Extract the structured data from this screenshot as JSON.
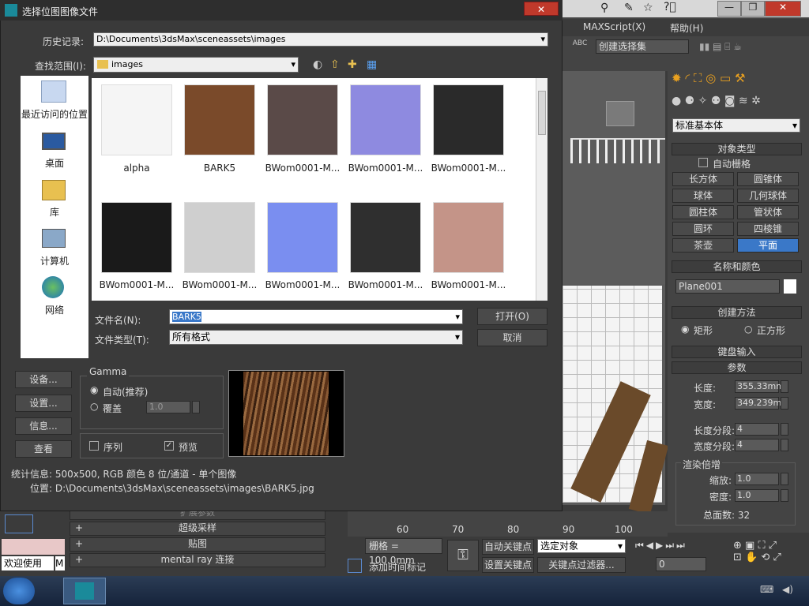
{
  "dialog": {
    "title": "选择位图图像文件",
    "history_label": "历史记录:",
    "history_value": "D:\\Documents\\3dsMax\\sceneassets\\images",
    "lookin_label": "查找范围(I):",
    "lookin_value": "images",
    "places": [
      {
        "label": "最近访问的位置",
        "icon": "recent-places-icon"
      },
      {
        "label": "桌面",
        "icon": "desktop-icon"
      },
      {
        "label": "库",
        "icon": "library-icon"
      },
      {
        "label": "计算机",
        "icon": "computer-icon"
      },
      {
        "label": "网络",
        "icon": "network-icon"
      }
    ],
    "files": [
      {
        "name": "alpha",
        "color": "#f5f5f5"
      },
      {
        "name": "BARK5",
        "color": "#7a4a2a"
      },
      {
        "name": "BWom0001-M...",
        "color": "#5a4a48"
      },
      {
        "name": "BWom0001-M...",
        "color": "#8e8ae0"
      },
      {
        "name": "BWom0001-M...",
        "color": "#2a2a2a"
      },
      {
        "name": "BWom0001-M...",
        "color": "#1a1a1a"
      },
      {
        "name": "BWom0001-M...",
        "color": "#cfcfcf"
      },
      {
        "name": "BWom0001-M...",
        "color": "#7a8ef0"
      },
      {
        "name": "BWom0001-M...",
        "color": "#2f2f2f"
      },
      {
        "name": "BWom0001-M...",
        "color": "#c49488"
      }
    ],
    "filename_label": "文件名(N):",
    "filename_value": "BARK5",
    "filetype_label": "文件类型(T):",
    "filetype_value": "所有格式",
    "open_button": "打开(O)",
    "cancel_button": "取消",
    "setup_button": "设备...",
    "settings_button": "设置...",
    "info_button": "信息...",
    "view_button": "查看",
    "gamma_title": "Gamma",
    "gamma_auto": "自动(推荐)",
    "gamma_override": "覆盖",
    "gamma_value": "1.0",
    "sequence_label": "序列",
    "preview_label": "预览",
    "stats": "统计信息: 500x500, RGB 颜色 8 位/通道 - 单个图像",
    "location": "位置: D:\\Documents\\3dsMax\\sceneassets\\images\\BARK5.jpg"
  },
  "max": {
    "menu_maxscript": "MAXScript(X)",
    "menu_help": "帮助(H)",
    "selection_set": "创建选择集",
    "standard_primitives": "标准基本体",
    "object_type_header": "对象类型",
    "auto_grid": "自动栅格",
    "objects": [
      "长方体",
      "圆锥体",
      "球体",
      "几何球体",
      "圆柱体",
      "管状体",
      "圆环",
      "四棱锥",
      "茶壶",
      "平面"
    ],
    "name_color_header": "名称和颜色",
    "object_name": "Plane001",
    "creation_method_header": "创建方法",
    "rect": "矩形",
    "square": "正方形",
    "keyboard_entry_header": "键盘输入",
    "params_header": "参数",
    "length_label": "长度:",
    "length_value": "355.33mm",
    "width_label": "宽度:",
    "width_value": "349.239m",
    "length_segs_label": "长度分段:",
    "length_segs_value": "4",
    "width_segs_label": "宽度分段:",
    "width_segs_value": "4",
    "render_mult_header": "渲染倍增",
    "scale_label": "缩放:",
    "scale_value": "1.0",
    "density_label": "密度:",
    "density_value": "1.0",
    "total_faces": "总面数: 32",
    "rollouts": [
      "扩展参数",
      "超级采样",
      "贴图",
      "mental ray 连接"
    ],
    "ruler": [
      "60",
      "70",
      "80",
      "90",
      "100"
    ],
    "grid": "栅格 = 100.0mm",
    "add_time_tag": "添加时间标记",
    "auto_key": "自动关键点",
    "set_key": "设置关键点",
    "selected_object": "选定对象",
    "key_filter": "关键点过滤器...",
    "frame_value": "0",
    "welcome": "欢迎使用",
    "welcome_tail": "M"
  }
}
